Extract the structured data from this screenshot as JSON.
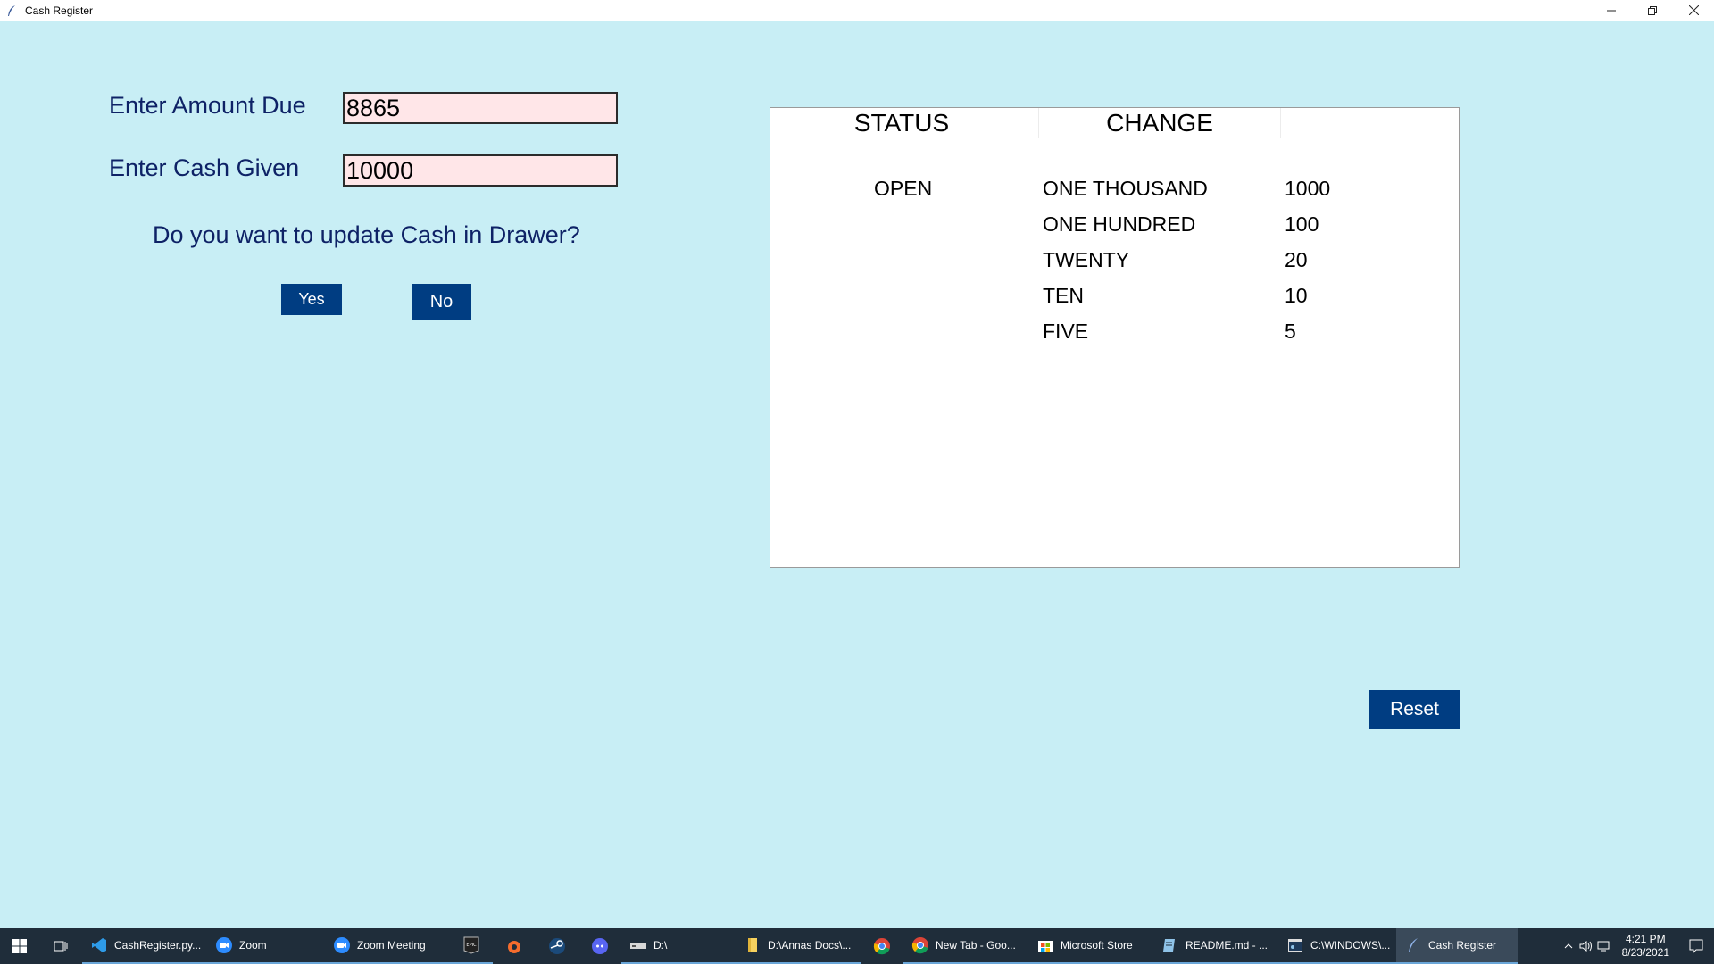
{
  "window": {
    "title": "Cash Register",
    "minimize_icon": "minimize-icon",
    "restore_icon": "restore-icon",
    "close_icon": "close-icon"
  },
  "form": {
    "amount_due_label": "Enter Amount Due",
    "amount_due_value": "8865",
    "cash_given_label": "Enter Cash Given",
    "cash_given_value": "10000",
    "question": "Do you want to update Cash in Drawer?",
    "yes_label": "Yes",
    "no_label": "No"
  },
  "panel": {
    "status_header": "STATUS",
    "change_header": "CHANGE",
    "status_value": "OPEN",
    "change_rows": [
      {
        "denomination": "ONE THOUSAND",
        "amount": "1000"
      },
      {
        "denomination": "ONE HUNDRED",
        "amount": "100"
      },
      {
        "denomination": "TWENTY",
        "amount": "20"
      },
      {
        "denomination": "TEN",
        "amount": "10"
      },
      {
        "denomination": "FIVE",
        "amount": "5"
      }
    ]
  },
  "reset_label": "Reset",
  "colors": {
    "background": "#c8eef5",
    "label_text": "#0e2266",
    "button_bg": "#003d82",
    "entry_bg": "#ffe6e8"
  },
  "taskbar": {
    "items": [
      {
        "label": "CashRegister.py...",
        "icon": "vscode-icon"
      },
      {
        "label": "Zoom",
        "icon": "zoom-icon"
      },
      {
        "label": "Zoom Meeting",
        "icon": "zoom-icon"
      },
      {
        "label": "D:\\",
        "icon": "drive-icon"
      },
      {
        "label": "D:\\Annas Docs\\...",
        "icon": "folder-icon"
      },
      {
        "label": "New Tab - Goo...",
        "icon": "chrome-icon"
      },
      {
        "label": "Microsoft Store",
        "icon": "store-icon"
      },
      {
        "label": "README.md - ...",
        "icon": "notepad-icon"
      },
      {
        "label": "C:\\WINDOWS\\...",
        "icon": "cmd-icon"
      },
      {
        "label": "Cash Register",
        "icon": "feather-icon"
      }
    ],
    "time": "4:21 PM",
    "date": "8/23/2021"
  }
}
